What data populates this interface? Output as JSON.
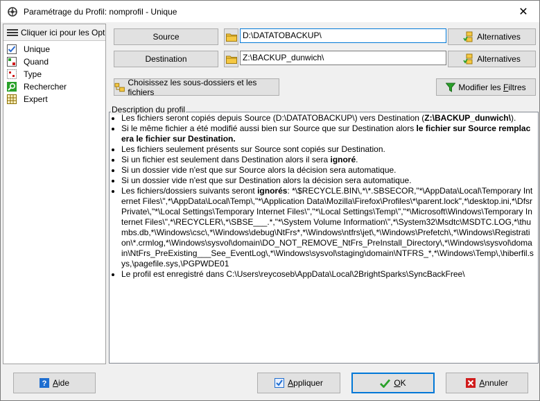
{
  "window": {
    "title": "Paramétrage du Profil: nomprofil - Unique",
    "close_glyph": "✕"
  },
  "left_panel": {
    "header": "Cliquer ici pour les Opti",
    "items": [
      {
        "label": "Unique",
        "icon": "check-list-icon"
      },
      {
        "label": "Quand",
        "icon": "calendar-icon"
      },
      {
        "label": "Type",
        "icon": "type-icon"
      },
      {
        "label": "Rechercher",
        "icon": "search-icon"
      },
      {
        "label": "Expert",
        "icon": "grid-icon"
      }
    ]
  },
  "source": {
    "button": "Source",
    "path": "D:\\DATATOBACKUP\\",
    "alternatives": "Alternatives"
  },
  "destination": {
    "button": "Destination",
    "path": "Z:\\BACKUP_dunwich\\",
    "alternatives": "Alternatives"
  },
  "buttons": {
    "subfolders": "Choisissez les sous-dossiers et les fichiers",
    "filters_pre": "Modifier les ",
    "filters_u": "F",
    "filters_post": "iltres"
  },
  "description": {
    "label": "Description du profil",
    "b1_pre": "Les fichiers seront copiés depuis Source (D:\\DATATOBACKUP\\) vers Destination (",
    "b1_bold": "Z:\\BACKUP_dunwich\\",
    "b1_post": ").",
    "b2_pre": "Si le même fichier a été modifié aussi bien sur Source que sur Destination alors ",
    "b2_bold": "le fichier sur Source remplacera le fichier sur Destination.",
    "b3": "Les fichiers seulement présents sur Source sont copiés sur Destination.",
    "b4_pre": "Si un fichier est seulement dans Destination alors il sera ",
    "b4_bold": "ignoré",
    "b4_post": ".",
    "b5": "Si un dossier vide n'est que sur Source alors la décision sera automatique.",
    "b6": "Si un dossier vide n'est que sur Destination alors la décision sera automatique.",
    "b7_pre": "Les fichiers/dossiers suivants seront ",
    "b7_bold": "ignorés",
    "b7_post": ": *\\$RECYCLE.BIN\\,*\\*.SBSECOR,\"*\\AppData\\Local\\Temporary Internet Files\\\",*\\AppData\\Local\\Temp\\,\"*\\Application Data\\Mozilla\\Firefox\\Profiles\\*\\parent.lock\",*\\desktop.ini,*\\DfsrPrivate\\,\"*\\Local Settings\\Temporary Internet Files\\\",\"*\\Local Settings\\Temp\\\",\"*\\Microsoft\\Windows\\Temporary Internet Files\\\",*\\RECYCLER\\,*\\SBSE___.*,\"*\\System Volume Information\\\",*\\System32\\Msdtc\\MSDTC.LOG,*\\thumbs.db,*\\Windows\\csc\\,*\\Windows\\debug\\NtFrs*,*\\Windows\\ntfrs\\jet\\,*\\Windows\\Prefetch\\,*\\Windows\\Registration\\*.crmlog,*\\Windows\\sysvol\\domain\\DO_NOT_REMOVE_NtFrs_PreInstall_Directory\\,*\\Windows\\sysvol\\domain\\NtFrs_PreExisting___See_EventLog\\,*\\Windows\\sysvol\\staging\\domain\\NTFRS_*,*\\Windows\\Temp\\,\\hiberfil.sys,\\pagefile.sys,\\PGPWDE01",
    "b8": "Le profil est enregistré dans C:\\Users\\reycoseb\\AppData\\Local\\2BrightSparks\\SyncBackFree\\"
  },
  "footer": {
    "help_u": "A",
    "help_rest": "ide",
    "apply_u": "A",
    "apply_rest": "ppliquer",
    "ok_u": "O",
    "ok_rest": "K",
    "cancel_u": "A",
    "cancel_rest": "nnuler"
  },
  "colors": {
    "accent": "#0078d7",
    "ok_green": "#2aa12a",
    "cancel_red": "#d01c1c",
    "help_blue": "#1e6ed0"
  }
}
